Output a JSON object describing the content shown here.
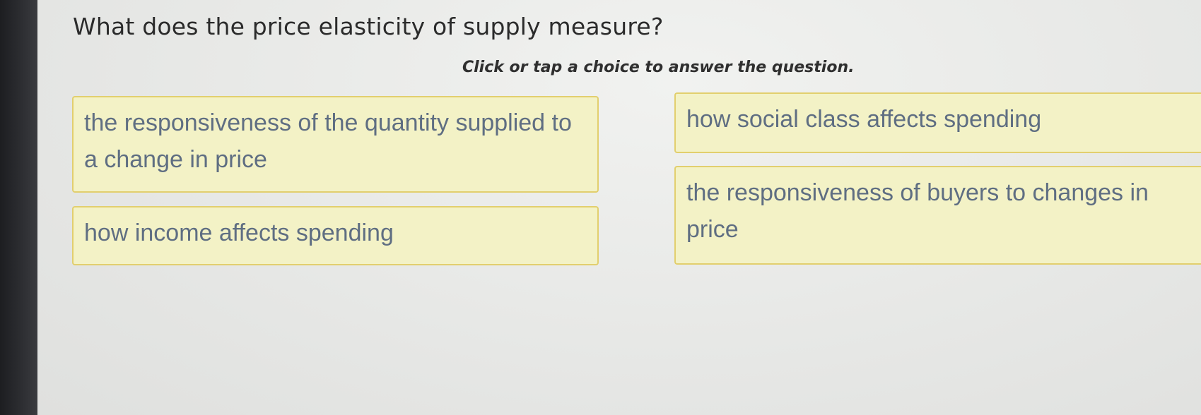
{
  "question": {
    "text": "What does the price elasticity of supply measure?"
  },
  "instruction": {
    "text": "Click or tap a choice to answer the question."
  },
  "choices": [
    {
      "label": "the responsiveness of the quantity supplied to a change in price"
    },
    {
      "label": "how income affects spending"
    },
    {
      "label": "how social class affects spending"
    },
    {
      "label": "the responsiveness of buyers to changes in price"
    }
  ],
  "colors": {
    "choice_background": "#f3f2c6",
    "choice_border": "#e2cf6e",
    "choice_text": "#5f6e82",
    "page_background": "#e9eae8"
  }
}
